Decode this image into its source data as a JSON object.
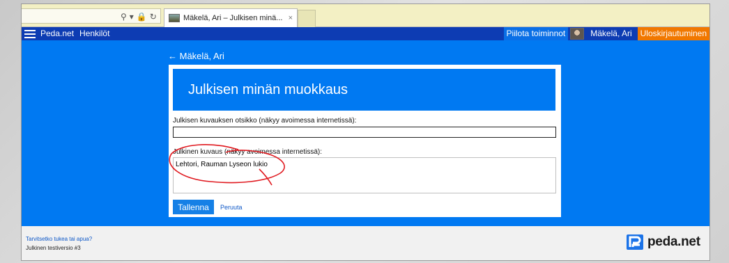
{
  "browser": {
    "tab": {
      "title": "Mäkelä, Ari – Julkisen minä...",
      "close": "×"
    },
    "address_icons": [
      "search-icon",
      "dropdown-icon",
      "lock-icon",
      "refresh-icon"
    ]
  },
  "topbar": {
    "brand": "Peda.net",
    "nav": [
      "Henkilöt"
    ],
    "hide_functions": "Piilota toiminnot",
    "user_name": "Mäkelä, Ari",
    "logout": "Uloskirjautuminen"
  },
  "page": {
    "back_link": "← Mäkelä, Ari",
    "title": "Julkisen minän muokkaus",
    "form": {
      "title_label": "Julkisen kuvauksen otsikko (näkyy avoimessa internetissä):",
      "title_value": "",
      "description_label": "Julkinen kuvaus (näkyy avoimessa internetissä):",
      "description_value": "Lehtori, Rauman Lyseon lukio",
      "save": "Tallenna",
      "cancel": "Peruuta"
    }
  },
  "footer": {
    "help": "Tarvitsetko tukea tai apua?",
    "version": "Julkinen testiversio #3",
    "brand": "peda.net"
  },
  "colors": {
    "page_bg": "#0079f2",
    "topbar_bg": "#0d3cb3",
    "logout_bg": "#f17800",
    "save_button": "#1580e6",
    "annotation": "#e0191f"
  }
}
